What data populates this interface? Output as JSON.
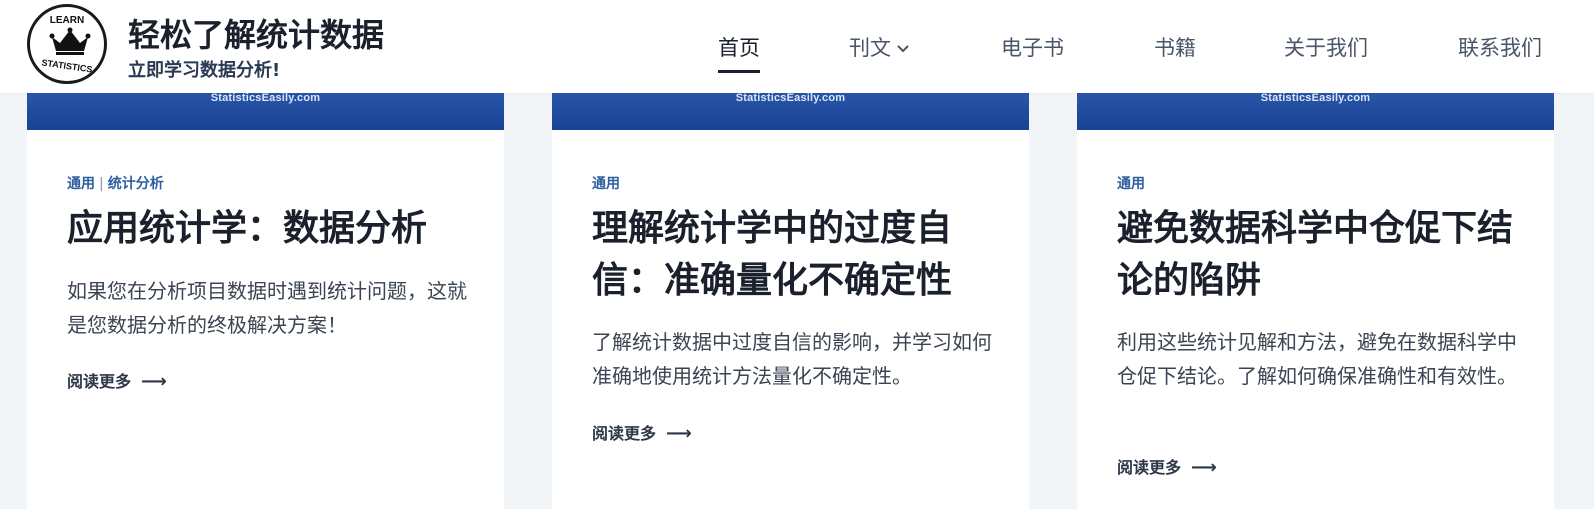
{
  "header": {
    "logo_top": "LEARN",
    "logo_bottom": "STATISTICS",
    "site_title": "轻松了解统计数据",
    "tagline": "立即学习数据分析!"
  },
  "nav": {
    "items": [
      {
        "label": "首页",
        "active": true
      },
      {
        "label": "刊文",
        "dropdown": true
      },
      {
        "label": "电子书"
      },
      {
        "label": "书籍"
      },
      {
        "label": "关于我们"
      },
      {
        "label": "联系我们"
      }
    ]
  },
  "cards": [
    {
      "image_caption": "StatisticsEasily.com",
      "categories": [
        "通用",
        "统计分析"
      ],
      "title": "应用统计学：数据分析",
      "excerpt": "如果您在分析项目数据时遇到统计问题，这就是您数据分析的终极解决方案！",
      "read_more": "阅读更多"
    },
    {
      "image_caption": "StatisticsEasily.com",
      "categories": [
        "通用"
      ],
      "title": "理解统计学中的过度自信：准确量化不确定性",
      "excerpt": "了解统计数据中过度自信的影响，并学习如何准确地使用统计方法量化不确定性。",
      "read_more": "阅读更多"
    },
    {
      "image_caption": "StatisticsEasily.com",
      "categories": [
        "通用"
      ],
      "title": "避免数据科学中仓促下结论的陷阱",
      "excerpt": "利用这些统计见解和方法，避免在数据科学中仓促下结论。了解如何确保准确性和有效性。",
      "read_more": "阅读更多"
    }
  ],
  "colors": {
    "card_image": "#1f4fa6",
    "category": "#2d5e9e",
    "background": "#f2f5f8"
  }
}
